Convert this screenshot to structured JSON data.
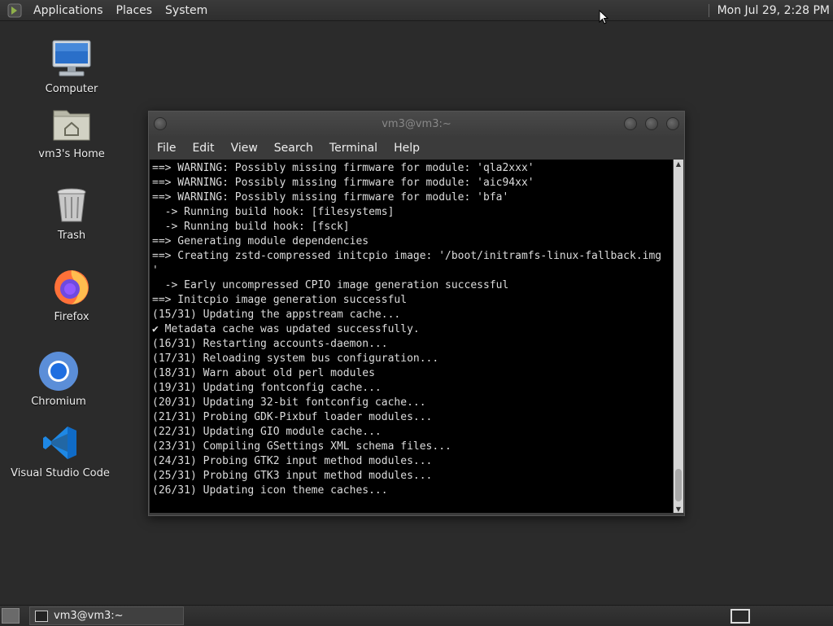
{
  "top_panel": {
    "menus": [
      "Applications",
      "Places",
      "System"
    ],
    "clock": "Mon Jul 29,  2:28 PM"
  },
  "desktop": {
    "icons": [
      {
        "label": "Computer",
        "icon": "computer-icon"
      },
      {
        "label": "vm3's Home",
        "icon": "home-folder-icon"
      },
      {
        "label": "Trash",
        "icon": "trash-icon"
      },
      {
        "label": "Firefox",
        "icon": "firefox-icon"
      },
      {
        "label": "Chromium",
        "icon": "chromium-icon"
      },
      {
        "label": "Visual Studio Code",
        "icon": "vscode-icon"
      }
    ]
  },
  "terminal": {
    "title": "vm3@vm3:~",
    "menu": [
      "File",
      "Edit",
      "View",
      "Search",
      "Terminal",
      "Help"
    ],
    "lines": [
      "==> WARNING: Possibly missing firmware for module: 'qla2xxx'",
      "==> WARNING: Possibly missing firmware for module: 'aic94xx'",
      "==> WARNING: Possibly missing firmware for module: 'bfa'",
      "  -> Running build hook: [filesystems]",
      "  -> Running build hook: [fsck]",
      "==> Generating module dependencies",
      "==> Creating zstd-compressed initcpio image: '/boot/initramfs-linux-fallback.img",
      "'",
      "  -> Early uncompressed CPIO image generation successful",
      "==> Initcpio image generation successful",
      "(15/31) Updating the appstream cache...",
      "✔ Metadata cache was updated successfully.",
      "(16/31) Restarting accounts-daemon...",
      "(17/31) Reloading system bus configuration...",
      "(18/31) Warn about old perl modules",
      "(19/31) Updating fontconfig cache...",
      "(20/31) Updating 32-bit fontconfig cache...",
      "(21/31) Probing GDK-Pixbuf loader modules...",
      "(22/31) Updating GIO module cache...",
      "(23/31) Compiling GSettings XML schema files...",
      "(24/31) Probing GTK2 input method modules...",
      "(25/31) Probing GTK3 input method modules...",
      "(26/31) Updating icon theme caches..."
    ]
  },
  "taskbar": {
    "task_label": "vm3@vm3:~"
  }
}
